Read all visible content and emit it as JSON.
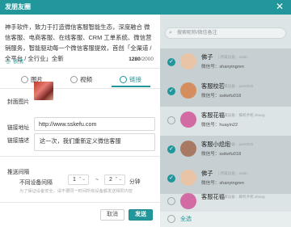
{
  "window": {
    "title": "发朋友圈",
    "close_glyph": "✕"
  },
  "compose": {
    "text": "神手软件，致力于打造微信客服智能生态，深度融合 微信客服、电商客服、在线客服、CRM 工单系统、微信营销服务，智能驱动每一个微信客服提效，首创「全渠道 / 全平台 / 全行业」全新",
    "emoji_label": "表情",
    "char_count": "1280",
    "char_max": "/2000"
  },
  "tabs": [
    {
      "label": "图片"
    },
    {
      "label": "视频"
    },
    {
      "label": "链接",
      "active": true
    }
  ],
  "form": {
    "cover_label": "封面图片",
    "link_label": "链接地址",
    "link_value": "http://www.sskefu.com",
    "desc_label": "链接描述",
    "desc_value": "这一次，我们重新定义微信客服",
    "interval_title": "推送间隔",
    "interval_prefix": "不同设备间隔",
    "interval_from": "1",
    "interval_sep": "~",
    "interval_to": "2",
    "interval_unit": "分钟",
    "interval_hint": "为了保证设备安全，请不要同一时间所有设备都发送相同内容"
  },
  "actions": {
    "cancel": "取消",
    "send": "发送"
  },
  "contacts_panel": {
    "search_placeholder": "搜索昵称/微信备注",
    "search_icon": "magnifier-icon",
    "items": [
      {
        "name": "佛子",
        "tag": "| 所属设备：10ab",
        "wx": "微信号：shanyingren",
        "checked": true,
        "avatar_color": "#e9c4a6"
      },
      {
        "name": "客服校若",
        "tag": "| 所属设备：pan0020",
        "wx": "微信号：ssikefu018",
        "checked": true,
        "avatar_color": "#d58f5e"
      },
      {
        "name": "客服花福",
        "tag": "| 所属设备：脚机手机 shang",
        "wx": "微信号：huayin22",
        "checked": false,
        "avatar_color": "#d26aa4"
      },
      {
        "name": "客服小熄炮",
        "tag": "| 所属设备：pan0020",
        "wx": "微信号：ssikefu018",
        "checked": true,
        "avatar_color": "#a87a63"
      },
      {
        "name": "佛子",
        "tag": "| 所属设备：10ab",
        "wx": "微信号：shanyingren",
        "checked": true,
        "avatar_color": "#e9c4a6"
      },
      {
        "name": "客服花福",
        "tag": "| 所属设备：脚机手机 shang",
        "wx": "微信号：huayin22",
        "checked": false,
        "avatar_color": "#d26aa4"
      }
    ],
    "select_all": "全选"
  },
  "colors": {
    "accent": "#21969b",
    "panel": "#dde4e6"
  }
}
